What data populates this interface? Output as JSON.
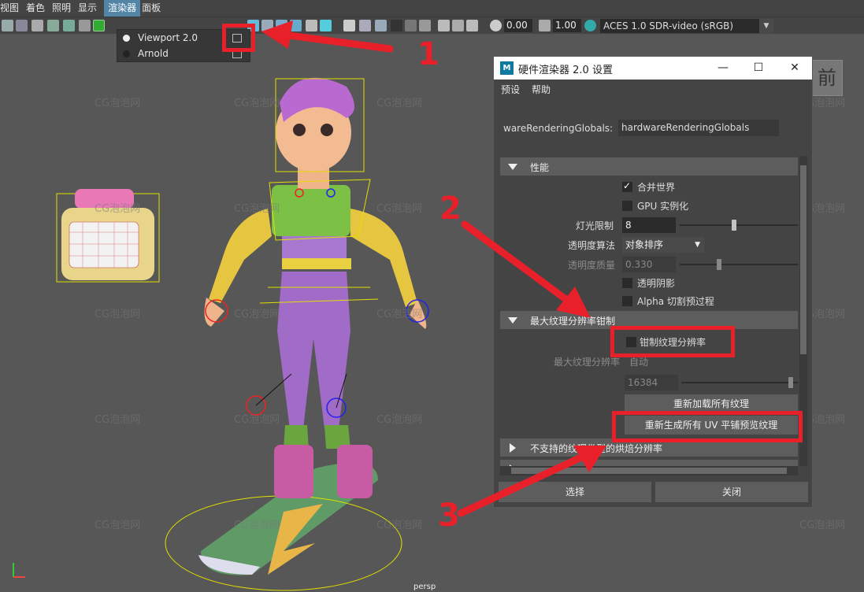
{
  "menubar": {
    "items": [
      "视图",
      "着色",
      "照明",
      "显示",
      "渲染器",
      "面板"
    ],
    "active_index": 4
  },
  "toolbar": {
    "exposure_value": "0.00",
    "gamma_value": "1.00",
    "color_space": "ACES 1.0 SDR-video (sRGB)"
  },
  "renderer_menu": {
    "items": [
      {
        "label": "Viewport 2.0",
        "selected": true
      },
      {
        "label": "Arnold",
        "selected": false
      }
    ]
  },
  "viewport": {
    "watermark": "CG泡泡网",
    "view_cube_label": "前",
    "camera_label": "persp"
  },
  "dialog": {
    "title": "硬件渲染器 2.0 设置",
    "logo_text": "M",
    "window_buttons": [
      "—",
      "☐",
      "✕"
    ],
    "menu": [
      "预设",
      "帮助"
    ],
    "node_label": "wareRenderingGlobals:",
    "node_value": "hardwareRenderingGlobals",
    "sections": {
      "performance": "性能",
      "max_texture": "最大纹理分辨率钳制",
      "unsupported": "不支持的纹理类型的烘焙分辨率"
    },
    "options": {
      "merge_world": "合并世界",
      "gpu_instancing": "GPU 实例化",
      "light_limit_label": "灯光限制",
      "light_limit_value": "8",
      "transparency_algorithm_label": "透明度算法",
      "transparency_algorithm_value": "对象排序",
      "transparency_quality_label": "透明度质量",
      "transparency_quality_value": "0.330",
      "transparent_shadows": "透明阴影",
      "alpha_cut_prepass": "Alpha 切割预过程",
      "clamp_texture_resolution": "钳制纹理分辨率",
      "max_texture_res_label": "最大纹理分辨率",
      "max_texture_res_mode": "自动",
      "max_texture_res_value": "16384",
      "reload_all_textures": "重新加载所有纹理",
      "regen_uv_tile_preview": "重新生成所有 UV 平铺预览纹理"
    },
    "footer": {
      "select": "选择",
      "close": "关闭"
    }
  },
  "annotations": {
    "numbers": [
      "1",
      "2",
      "3"
    ],
    "color": "#e8202a"
  },
  "colors": {
    "menubar_bg": "#444444",
    "menu_active": "#5285a6",
    "viewport_bg": "#575757",
    "annotation_red": "#e8202a"
  }
}
